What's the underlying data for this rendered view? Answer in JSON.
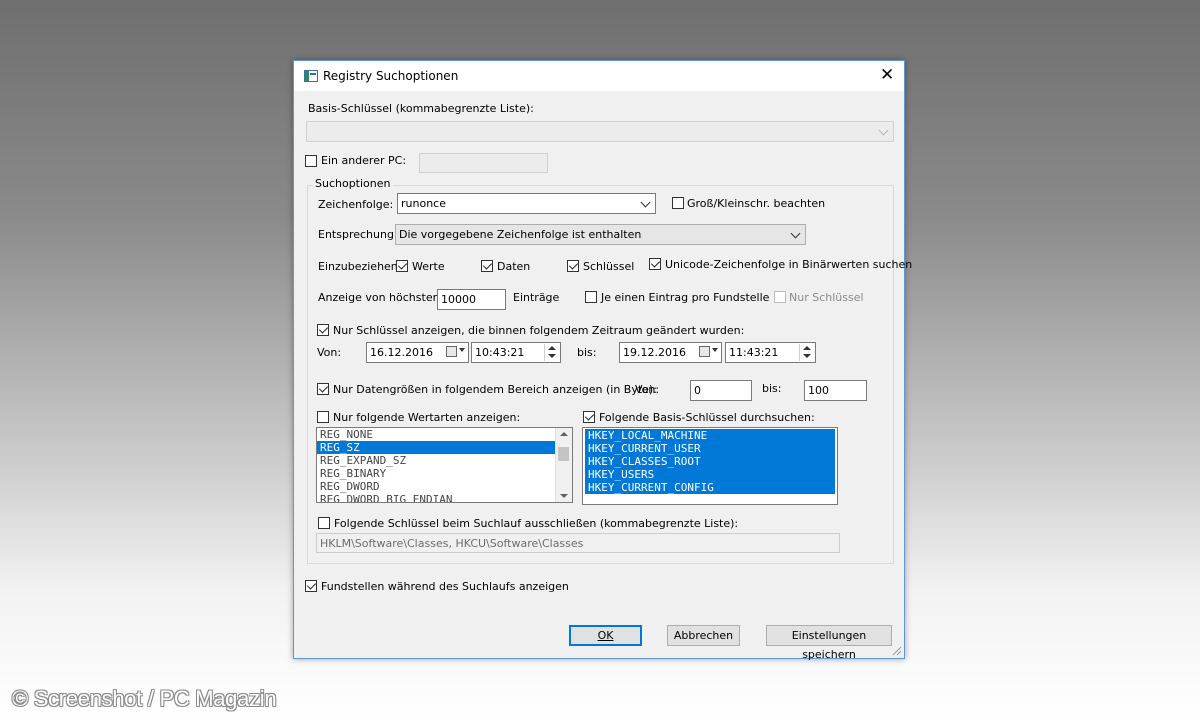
{
  "dialog": {
    "title": "Registry Suchoptionen",
    "basis_label": "Basis-Schlüssel (kommabegrenzte Liste):",
    "basis_value": "",
    "other_pc_label": "Ein anderer PC:",
    "other_pc_checked": false,
    "other_pc_value": ""
  },
  "suchoptionen": {
    "group_label": "Suchoptionen",
    "zeichenfolge_label": "Zeichenfolge:",
    "zeichenfolge_value": "runonce",
    "case_label": "Groß/Kleinschr. beachten",
    "case_checked": false,
    "entsprechung_label": "Entsprechung:",
    "entsprechung_value": "Die vorgegebene Zeichenfolge ist enthalten",
    "include_label": "Einzubeziehen:",
    "include_items": [
      {
        "label": "Werte",
        "checked": true
      },
      {
        "label": "Daten",
        "checked": true
      },
      {
        "label": "Schlüssel",
        "checked": true
      },
      {
        "label": "Unicode-Zeichenfolge in Binärwerten suchen",
        "checked": true
      }
    ],
    "max_label": "Anzeige von höchstens",
    "max_value": "10000",
    "max_suffix": "Einträge",
    "one_entry_label": "Je einen Eintrag pro Fundstelle",
    "one_entry_checked": false,
    "only_keys_label": "Nur Schlüssel",
    "only_keys_checked": false,
    "time_filter_label": "Nur Schlüssel anzeigen, die binnen folgendem Zeitraum geändert wurden:",
    "time_filter_checked": true,
    "from_label": "Von:",
    "from_date": "16.12.2016",
    "from_time": "10:43:21",
    "to_label": "bis:",
    "to_date": "19.12.2016",
    "to_time": "11:43:21",
    "size_filter_label": "Nur Datengrößen in folgendem Bereich anzeigen (in Byte):",
    "size_filter_checked": true,
    "size_from_label": "Von:",
    "size_from_value": "0",
    "size_to_label": "bis:",
    "size_to_value": "100",
    "value_types_label": "Nur folgende Wertarten anzeigen:",
    "value_types_checked": false,
    "value_types": [
      "REG_NONE",
      "REG_SZ",
      "REG_EXPAND_SZ",
      "REG_BINARY",
      "REG_DWORD",
      "REG_DWORD_BIG_ENDIAN"
    ],
    "value_types_selected_index": 1,
    "base_keys_label": "Folgende Basis-Schlüssel durchsuchen:",
    "base_keys_checked": true,
    "base_keys": [
      "HKEY_LOCAL_MACHINE",
      "HKEY_CURRENT_USER",
      "HKEY_CLASSES_ROOT",
      "HKEY_USERS",
      "HKEY_CURRENT_CONFIG"
    ],
    "exclude_label": "Folgende Schlüssel beim Suchlauf ausschließen (kommabegrenzte Liste):",
    "exclude_checked": false,
    "exclude_value": "HKLM\\Software\\Classes, HKCU\\Software\\Classes"
  },
  "show_results_label": "Fundstellen während des Suchlaufs anzeigen",
  "show_results_checked": true,
  "buttons": {
    "ok": "OK",
    "cancel": "Abbrechen",
    "save": "Einstellungen speichern"
  },
  "watermark": "© Screenshot / PC Magazin",
  "colors": {
    "selection": "#0078d7",
    "dialog_border": "#5a9bd5",
    "dialog_bg": "#f0f0f0"
  }
}
